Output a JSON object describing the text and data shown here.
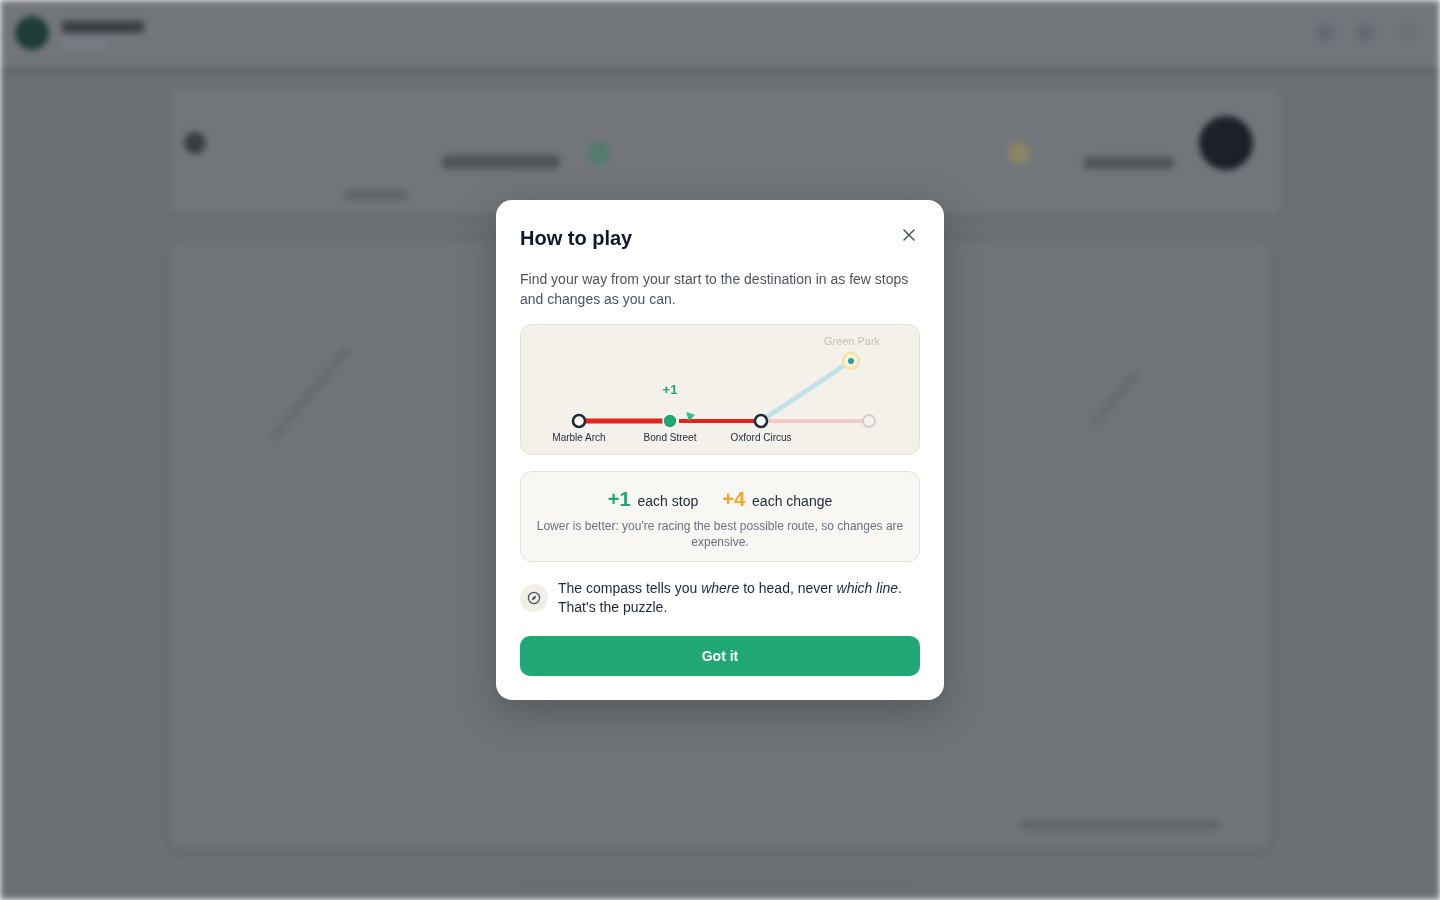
{
  "dialog": {
    "title": "How to play",
    "description": "Find your way from your start to the destination in as few stops and changes as you can."
  },
  "diagram": {
    "gain_label": "+1",
    "stations": [
      {
        "name": "Marble Arch",
        "kind": "stop"
      },
      {
        "name": "Bond Street",
        "kind": "current"
      },
      {
        "name": "Oxford Circus",
        "kind": "stop"
      },
      {
        "kind": "faded"
      },
      {
        "name": "Green Park",
        "kind": "target"
      }
    ]
  },
  "scoring": {
    "items": [
      {
        "points": "+1",
        "label": "each stop",
        "color": "#1fa774"
      },
      {
        "points": "+4",
        "label": "each change",
        "color": "#f5a524"
      }
    ],
    "note": "Lower is better: you're racing the best possible route, so changes are expensive."
  },
  "tip": {
    "text": "The compass tells you *where* to head, never *which line*. That's the puzzle."
  },
  "button": {
    "label": "Got it"
  }
}
